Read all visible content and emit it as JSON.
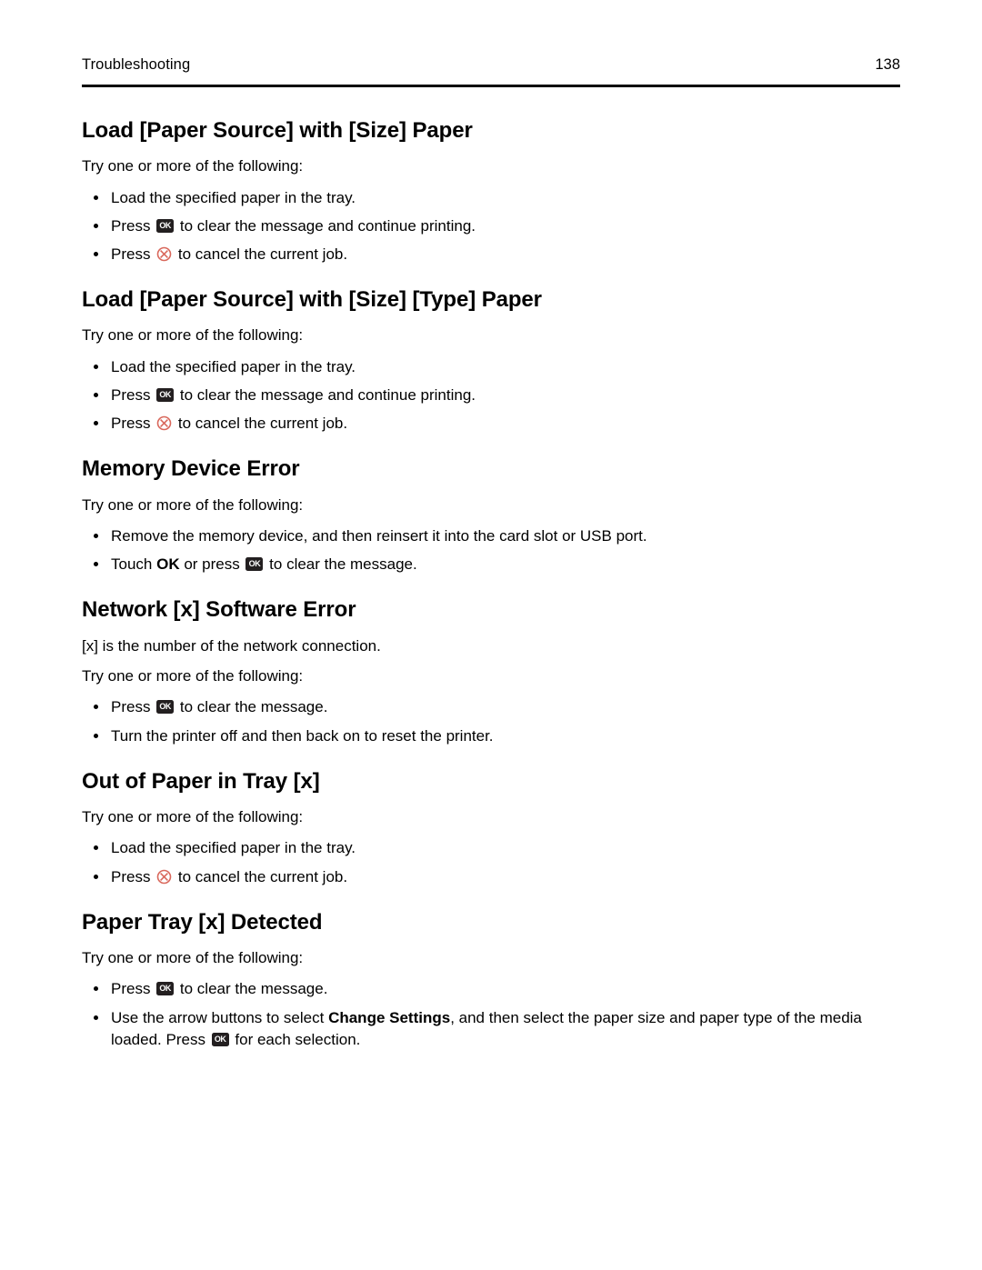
{
  "header": {
    "title": "Troubleshooting",
    "page_number": "138"
  },
  "icons": {
    "ok_label": "OK",
    "ok_icon_name": "ok-button-icon",
    "ok_icon_color": "#231f20",
    "cancel_icon_name": "cancel-button-icon",
    "cancel_icon_color": "#d9685c"
  },
  "sections": [
    {
      "heading": "Load [Paper Source] with [Size] Paper",
      "intro": "Try one or more of the following:",
      "bullets": [
        {
          "parts": [
            {
              "text": "Load the specified paper in the tray."
            }
          ]
        },
        {
          "parts": [
            {
              "text": "Press "
            },
            {
              "icon": "ok"
            },
            {
              "text": " to clear the message and continue printing."
            }
          ]
        },
        {
          "parts": [
            {
              "text": "Press "
            },
            {
              "icon": "cancel"
            },
            {
              "text": " to cancel the current job."
            }
          ]
        }
      ]
    },
    {
      "heading": "Load [Paper Source] with [Size] [Type] Paper",
      "intro": "Try one or more of the following:",
      "bullets": [
        {
          "parts": [
            {
              "text": "Load the specified paper in the tray."
            }
          ]
        },
        {
          "parts": [
            {
              "text": "Press "
            },
            {
              "icon": "ok"
            },
            {
              "text": " to clear the message and continue printing."
            }
          ]
        },
        {
          "parts": [
            {
              "text": "Press "
            },
            {
              "icon": "cancel"
            },
            {
              "text": " to cancel the current job."
            }
          ]
        }
      ]
    },
    {
      "heading": "Memory Device Error",
      "intro": "Try one or more of the following:",
      "bullets": [
        {
          "parts": [
            {
              "text": "Remove the memory device, and then reinsert it into the card slot or USB port."
            }
          ]
        },
        {
          "parts": [
            {
              "text": "Touch "
            },
            {
              "text": "OK",
              "bold": true
            },
            {
              "text": " or press "
            },
            {
              "icon": "ok"
            },
            {
              "text": " to clear the message."
            }
          ]
        }
      ]
    },
    {
      "heading": "Network [x] Software Error",
      "intro": "[x] is the number of the network connection.",
      "intro2": "Try one or more of the following:",
      "bullets": [
        {
          "parts": [
            {
              "text": "Press "
            },
            {
              "icon": "ok"
            },
            {
              "text": " to clear the message."
            }
          ]
        },
        {
          "parts": [
            {
              "text": "Turn the printer off and then back on to reset the printer."
            }
          ]
        }
      ]
    },
    {
      "heading": "Out of Paper in Tray [x]",
      "intro": "Try one or more of the following:",
      "bullets": [
        {
          "parts": [
            {
              "text": "Load the specified paper in the tray."
            }
          ]
        },
        {
          "parts": [
            {
              "text": "Press "
            },
            {
              "icon": "cancel"
            },
            {
              "text": " to cancel the current job."
            }
          ]
        }
      ]
    },
    {
      "heading": "Paper Tray [x] Detected",
      "intro": "Try one or more of the following:",
      "bullets": [
        {
          "parts": [
            {
              "text": "Press "
            },
            {
              "icon": "ok"
            },
            {
              "text": " to clear the message."
            }
          ]
        },
        {
          "parts": [
            {
              "text": "Use the arrow buttons to select "
            },
            {
              "text": "Change Settings",
              "bold": true
            },
            {
              "text": ", and then select the paper size and paper type of the media loaded. Press "
            },
            {
              "icon": "ok"
            },
            {
              "text": " for each selection."
            }
          ]
        }
      ]
    }
  ]
}
